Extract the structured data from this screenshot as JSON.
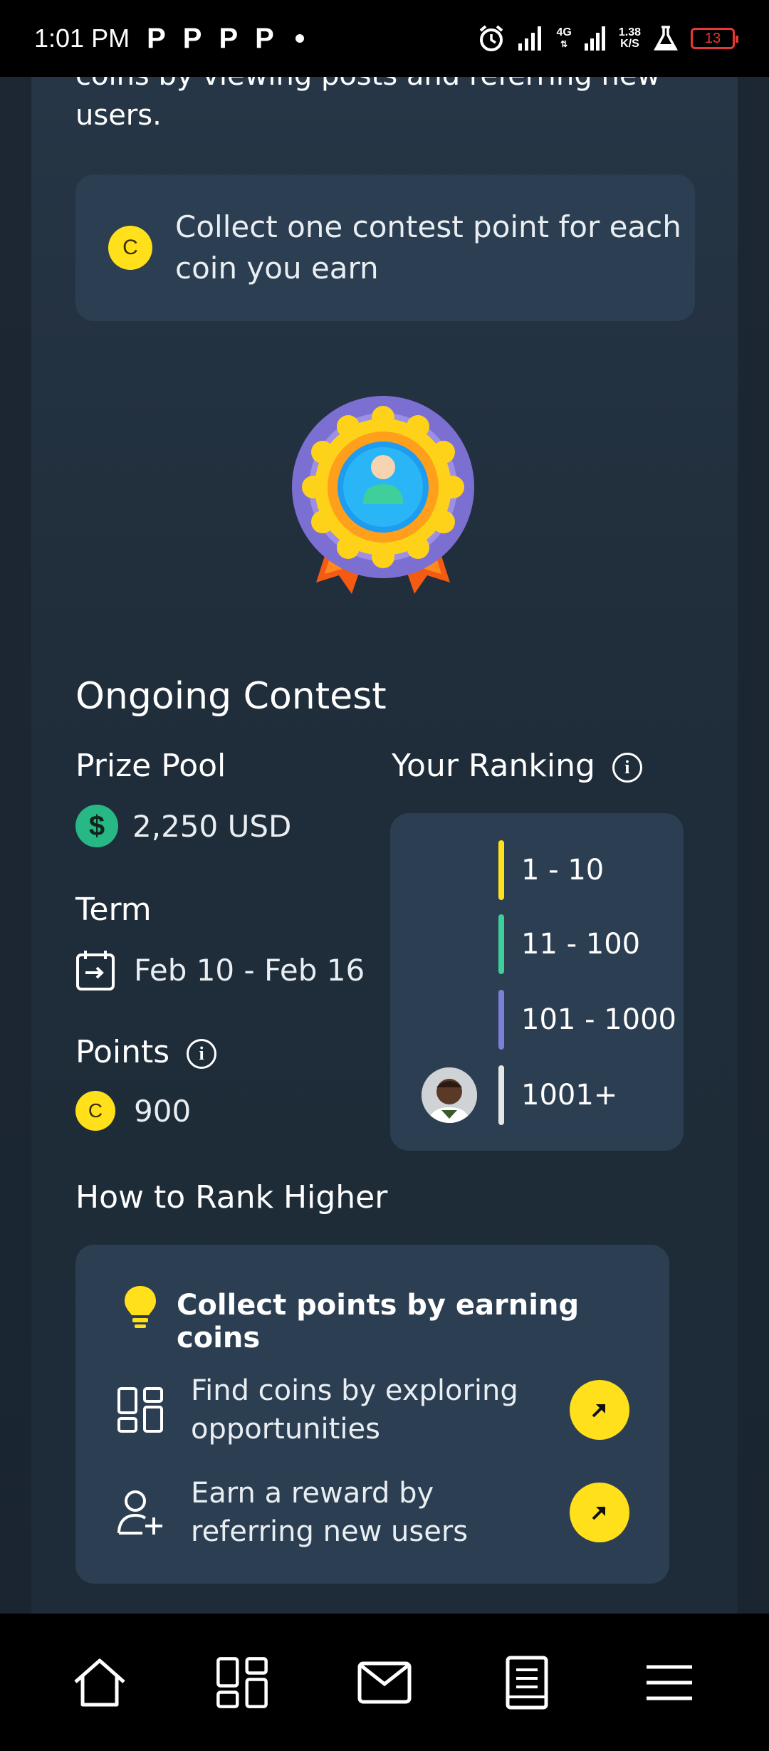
{
  "status_bar": {
    "time": "1:01 PM",
    "notification_icons": [
      "P",
      "P",
      "P",
      "P"
    ],
    "network": "4G",
    "speed_value": "1.38",
    "speed_unit": "K/S",
    "battery": "13"
  },
  "intro": {
    "text": "coins by viewing posts and referring new users."
  },
  "info_box": {
    "coin_letter": "C",
    "text": "Collect one contest point for each coin you earn"
  },
  "ongoing": {
    "title": "Ongoing Contest",
    "prize_pool_label": "Prize Pool",
    "prize_pool_icon": "$",
    "prize_pool_value": "2,250 USD",
    "term_label": "Term",
    "term_value": "Feb 10 - Feb 16",
    "points_label": "Points",
    "points_coin_letter": "C",
    "points_value": "900"
  },
  "ranking": {
    "title": "Your Ranking",
    "tiers": [
      {
        "label": "1 - 10",
        "color": "#ffe01b"
      },
      {
        "label": "11 - 100",
        "color": "#3fcf9b"
      },
      {
        "label": "101 - 1000",
        "color": "#7b7fd6"
      },
      {
        "label": "1001+",
        "color": "#e6e6e6"
      }
    ],
    "current_tier": "1001+"
  },
  "how_to": {
    "title": "How to Rank Higher",
    "card_title": "Collect points by earning coins",
    "items": [
      {
        "text": "Find coins by exploring opportunities",
        "icon": "grid-icon"
      },
      {
        "text": "Earn a reward by referring new users",
        "icon": "add-user-icon"
      }
    ]
  },
  "bottom_nav": [
    "home-icon",
    "dashboard-icon",
    "mail-icon",
    "document-icon",
    "menu-icon"
  ],
  "colors": {
    "accent": "#ffe01b",
    "card": "#2c3e51",
    "background": "#1c2733"
  }
}
